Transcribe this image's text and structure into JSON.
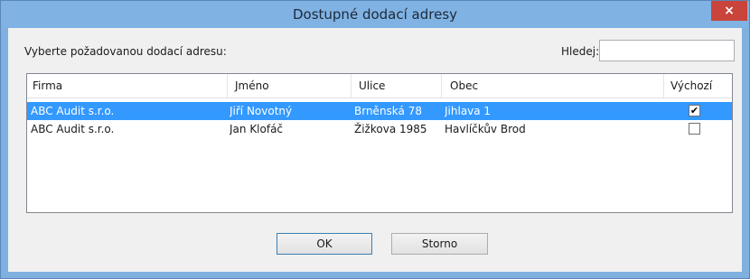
{
  "window": {
    "title": "Dostupné dodací adresy",
    "close_label": "×"
  },
  "form": {
    "prompt": "Vyberte požadovanou dodací adresu:",
    "search_label": "Hledej:",
    "search_value": ""
  },
  "table": {
    "columns": [
      "Firma",
      "Jméno",
      "Ulice",
      "Obec",
      "Výchozí"
    ],
    "rows": [
      {
        "firma": "ABC Audit s.r.o.",
        "jmeno": "Jiří Novotný",
        "ulice": "Brněnská 78",
        "obec": "Jihlava 1",
        "vychozi": "✔",
        "selected": true
      },
      {
        "firma": "ABC Audit s.r.o.",
        "jmeno": "Jan Klofáč",
        "ulice": "Žižkova 1985",
        "obec": "Havlíčkův Brod",
        "vychozi": "",
        "selected": false
      }
    ]
  },
  "buttons": {
    "ok": "OK",
    "cancel": "Storno"
  },
  "colors": {
    "title_bar": "#80b2e3",
    "selection": "#3399ff",
    "close_button": "#c9443a"
  }
}
